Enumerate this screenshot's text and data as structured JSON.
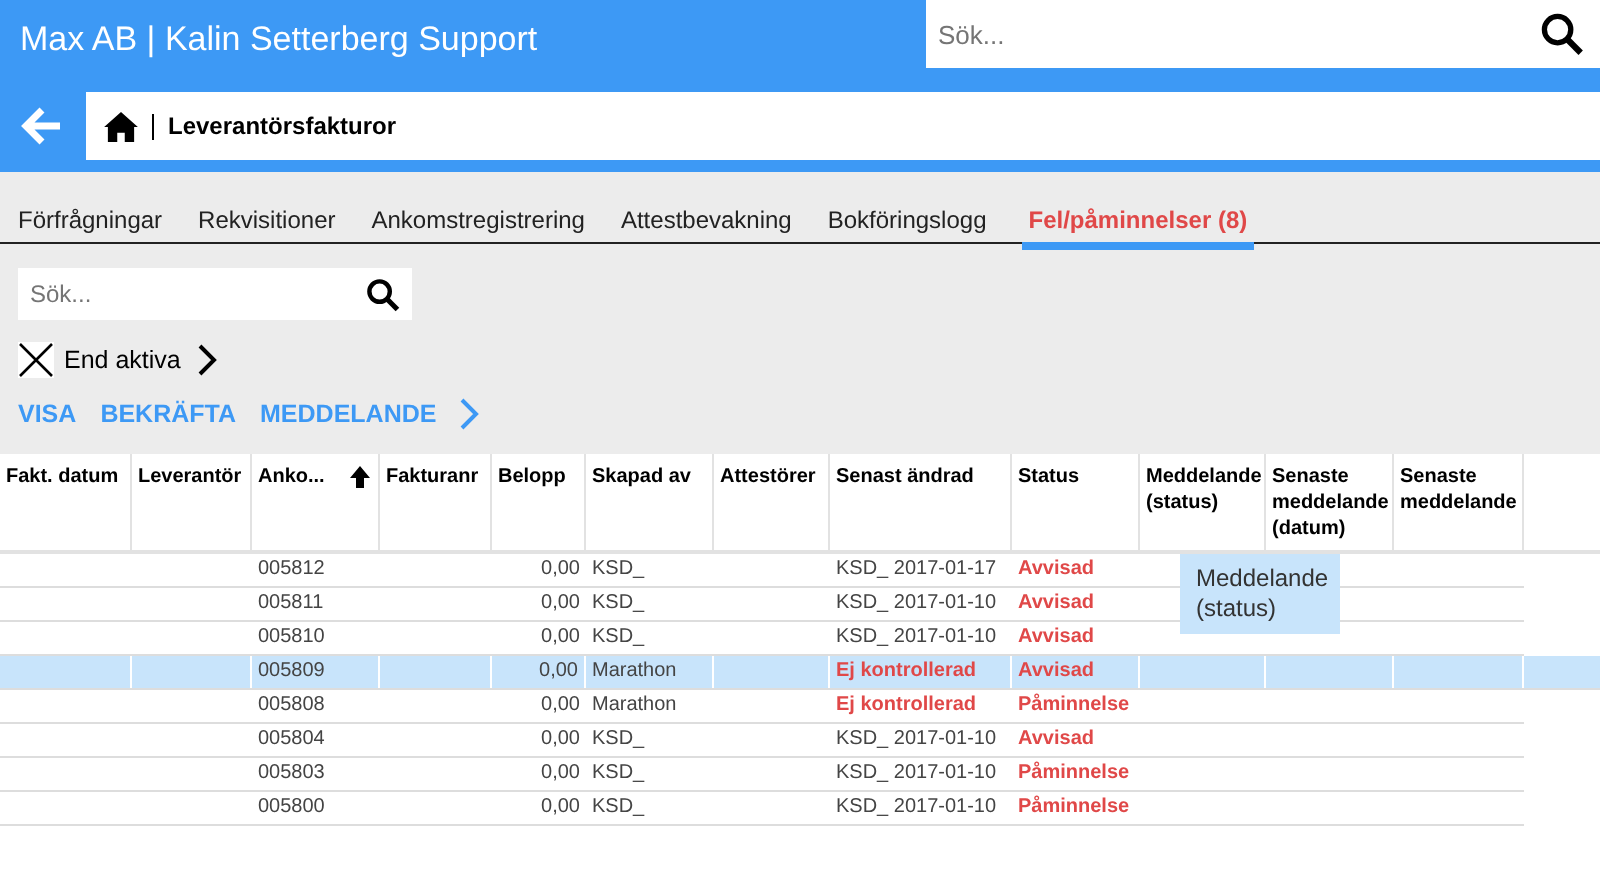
{
  "header": {
    "title": "Max AB | Kalin Setterberg Support",
    "search": {
      "placeholder": "Sök..."
    }
  },
  "breadcrumb": {
    "title": "Leverantörsfakturor"
  },
  "tabs": [
    {
      "label": "Förfrågningar",
      "selected": false
    },
    {
      "label": "Rekvisitioner",
      "selected": false
    },
    {
      "label": "Ankomstregistrering",
      "selected": false
    },
    {
      "label": "Attestbevakning",
      "selected": false
    },
    {
      "label": "Bokföringslogg",
      "selected": false
    },
    {
      "label": "Fel/påminnelser (8)",
      "selected": true
    }
  ],
  "filter": {
    "search": {
      "placeholder": "Sök..."
    },
    "only_active": {
      "label": "End aktiva",
      "checked": true
    }
  },
  "actions": [
    "VISA",
    "BEKRÄFTA",
    "MEDDELANDE"
  ],
  "table": {
    "columns": [
      {
        "label": "Fakt. datum",
        "sorted": false
      },
      {
        "label": "Leverantör",
        "sorted": false
      },
      {
        "label": "Anko...",
        "sorted": true
      },
      {
        "label": "Fakturanr",
        "sorted": false
      },
      {
        "label": "Belopp",
        "sorted": false
      },
      {
        "label": "Skapad av",
        "sorted": false
      },
      {
        "label": "Attestörer",
        "sorted": false
      },
      {
        "label": "Senast ändrad",
        "sorted": false
      },
      {
        "label": "Status",
        "sorted": false
      },
      {
        "label": "Meddelande (status)",
        "sorted": false
      },
      {
        "label": "Senaste meddelande (datum)",
        "sorted": false
      },
      {
        "label": "Senaste meddelande",
        "sorted": false
      }
    ],
    "rows": [
      {
        "cells": [
          "",
          "",
          "005812",
          "",
          "0,00",
          "KSD_",
          "",
          "KSD_ 2017-01-17",
          "Avvisad",
          "",
          "",
          ""
        ],
        "selected": false,
        "unchecked": false
      },
      {
        "cells": [
          "",
          "",
          "005811",
          "",
          "0,00",
          "KSD_",
          "",
          "KSD_ 2017-01-10",
          "Avvisad",
          "",
          "",
          ""
        ],
        "selected": false,
        "unchecked": false
      },
      {
        "cells": [
          "",
          "",
          "005810",
          "",
          "0,00",
          "KSD_",
          "",
          "KSD_ 2017-01-10",
          "Avvisad",
          "",
          "",
          ""
        ],
        "selected": false,
        "unchecked": false
      },
      {
        "cells": [
          "",
          "",
          "005809",
          "",
          "0,00",
          "Marathon",
          "",
          "Ej kontrollerad",
          "Avvisad",
          "",
          "",
          ""
        ],
        "selected": true,
        "unchecked": true
      },
      {
        "cells": [
          "",
          "",
          "005808",
          "",
          "0,00",
          "Marathon",
          "",
          "Ej kontrollerad",
          "Påminnelse",
          "",
          "",
          ""
        ],
        "selected": false,
        "unchecked": true
      },
      {
        "cells": [
          "",
          "",
          "005804",
          "",
          "0,00",
          "KSD_",
          "",
          "KSD_ 2017-01-10",
          "Avvisad",
          "",
          "",
          ""
        ],
        "selected": false,
        "unchecked": false
      },
      {
        "cells": [
          "",
          "",
          "005803",
          "",
          "0,00",
          "KSD_",
          "",
          "KSD_ 2017-01-10",
          "Påminnelse",
          "",
          "",
          ""
        ],
        "selected": false,
        "unchecked": false
      },
      {
        "cells": [
          "",
          "",
          "005800",
          "",
          "0,00",
          "KSD_",
          "",
          "KSD_ 2017-01-10",
          "Påminnelse",
          "",
          "",
          ""
        ],
        "selected": false,
        "unchecked": false
      }
    ],
    "tooltip": "Meddelande (status)"
  }
}
